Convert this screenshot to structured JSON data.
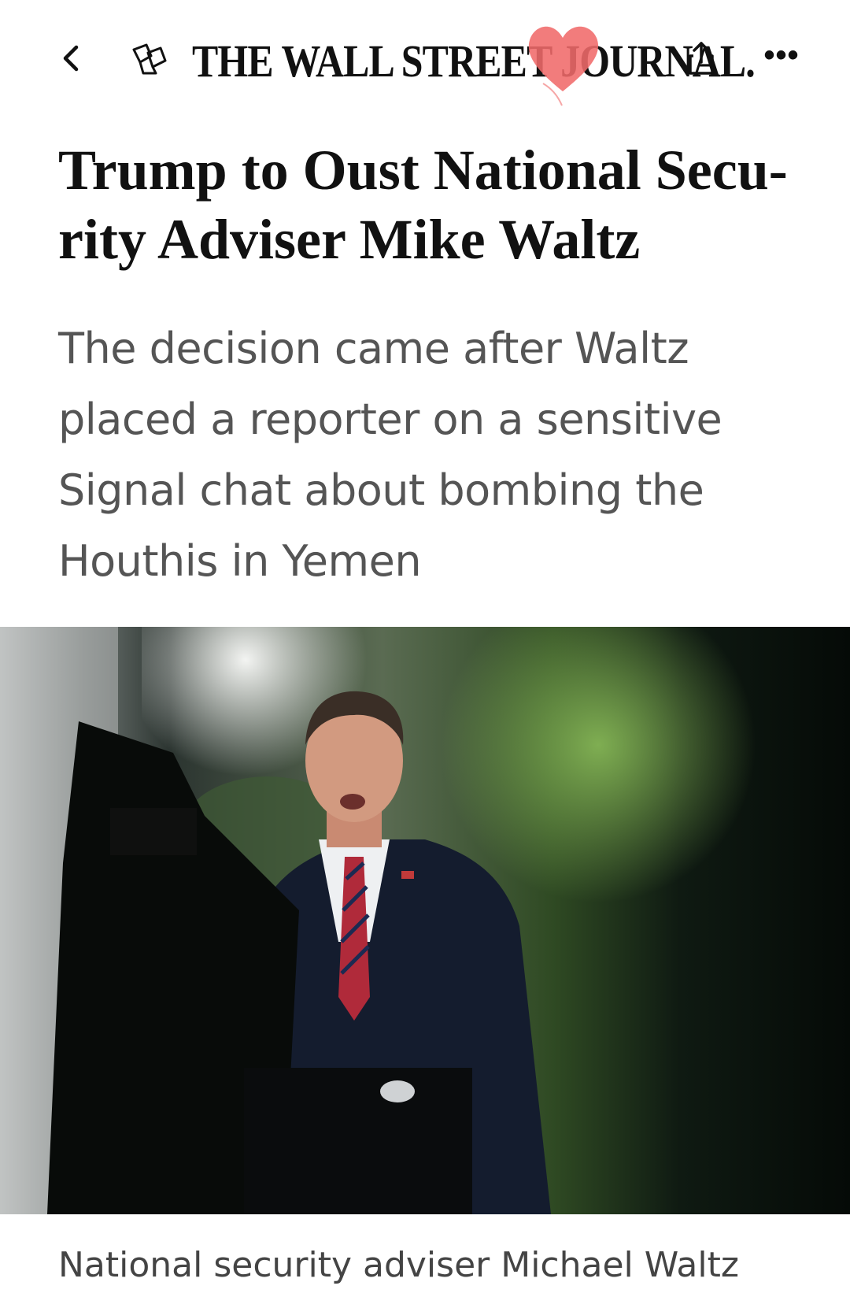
{
  "header": {
    "back_icon": "chevron-left-icon",
    "gift_icon": "gift-article-icon",
    "logo_text": "THE WALL STREET JOURNAL.",
    "share_icon": "share-icon",
    "more_icon": "more-options-icon",
    "more_glyph": "•••",
    "sticker_color": "#f06a6a"
  },
  "article": {
    "headline": "Trump to Oust National Secu-rity Adviser Mike Waltz",
    "dek": "The decision came after Waltz placed a reporter on a sensitive Signal chat about bombing the Houthis in Yemen",
    "caption": "National security adviser Michael Waltz"
  },
  "colors": {
    "text": "#111111",
    "dek": "#555555",
    "caption": "#444444"
  }
}
